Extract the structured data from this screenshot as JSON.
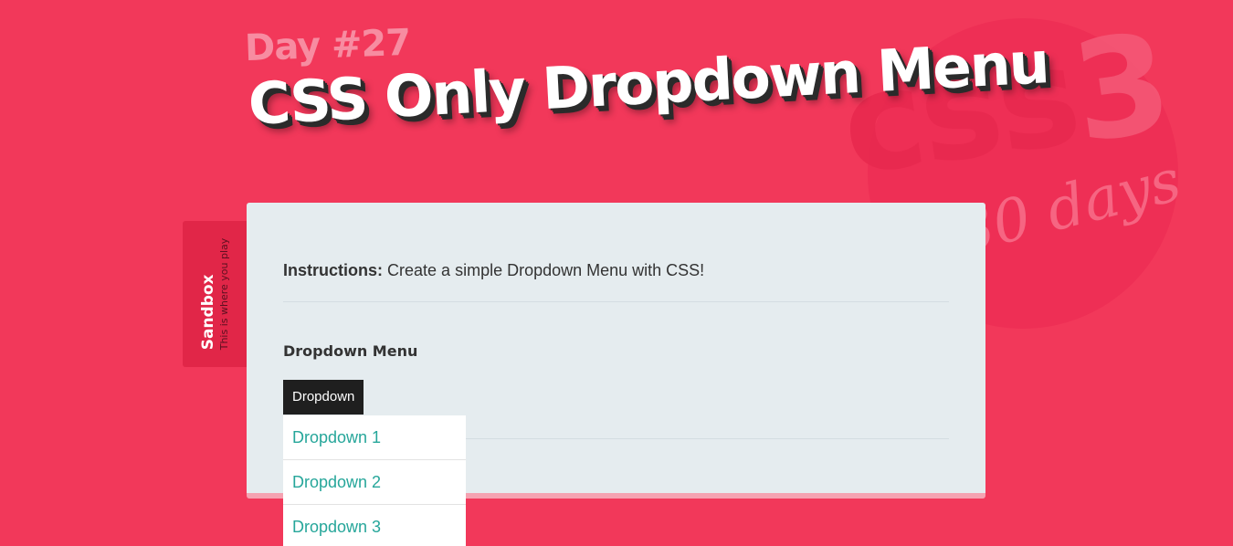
{
  "header": {
    "day_label": "Day #27",
    "title": "CSS Only Dropdown Menu"
  },
  "badge": {
    "css_text": "css",
    "css_number": "3",
    "days_text": "30 days"
  },
  "sandbox": {
    "title": "Sandbox",
    "subtitle": "This is where you play"
  },
  "card": {
    "instructions_label": "Instructions:",
    "instructions_text": "Create a simple Dropdown Menu with CSS!",
    "section_title": "Dropdown Menu",
    "dropdown_button_label": "Dropdown",
    "menu_items": [
      {
        "label": "Dropdown 1"
      },
      {
        "label": "Dropdown 2"
      },
      {
        "label": "Dropdown 3"
      }
    ]
  },
  "colors": {
    "background": "#f2385a",
    "card_background": "#e5ecef",
    "link_color": "#26a69a",
    "button_background": "#1f1f1f"
  }
}
